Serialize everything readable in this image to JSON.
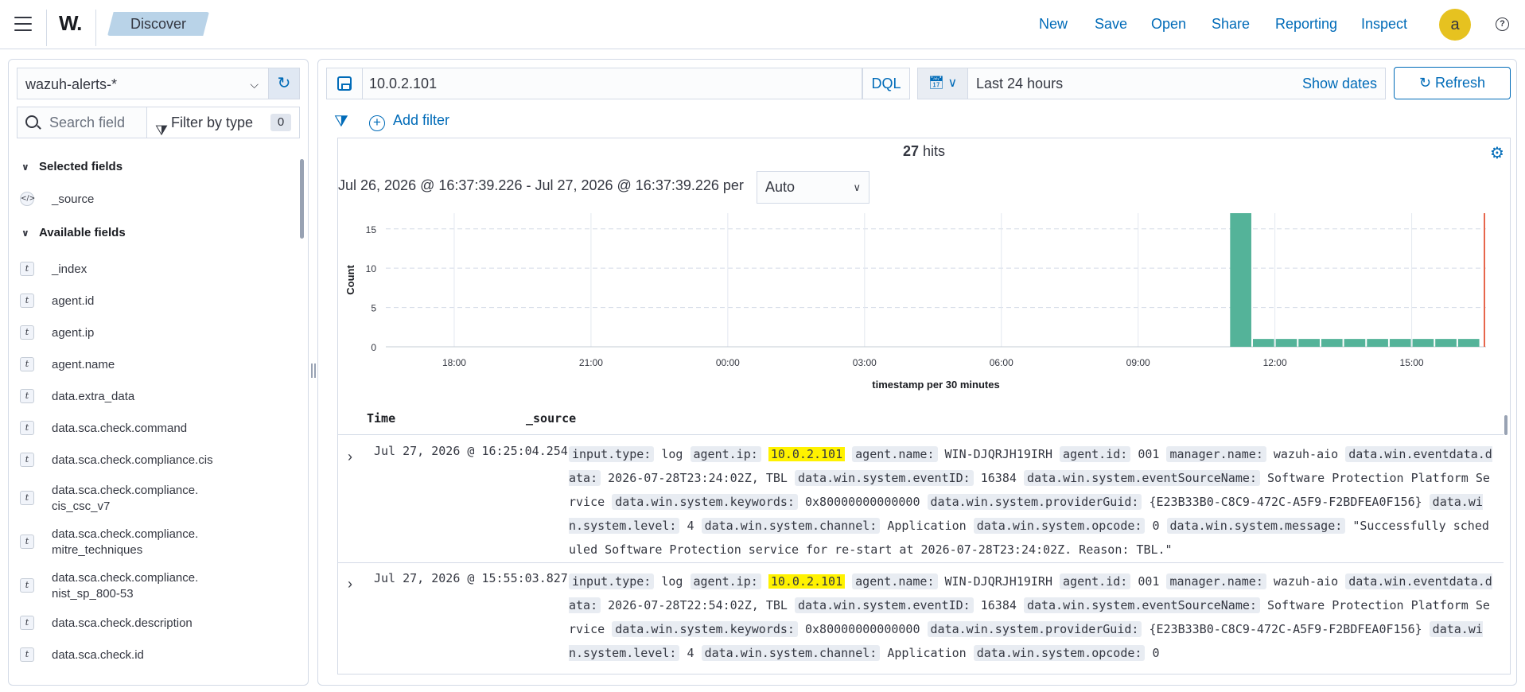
{
  "header": {
    "logo": "W.",
    "breadcrumb": "Discover",
    "nav": [
      "New",
      "Save",
      "Open",
      "Share",
      "Reporting",
      "Inspect"
    ],
    "avatar": "a",
    "help": "?"
  },
  "sidebar": {
    "index_pattern": "wazuh-alerts-*",
    "search_placeholder": "Search field",
    "filter_by_type_label": "Filter by type",
    "filter_count": "0",
    "selected_fields_title": "Selected fields",
    "selected_fields": [
      {
        "name": "_source",
        "type": "source"
      }
    ],
    "available_fields_title": "Available fields",
    "available_fields": [
      {
        "name": "_index",
        "type": "t"
      },
      {
        "name": "agent.id",
        "type": "t"
      },
      {
        "name": "agent.ip",
        "type": "t"
      },
      {
        "name": "agent.name",
        "type": "t"
      },
      {
        "name": "data.extra_data",
        "type": "t"
      },
      {
        "name": "data.sca.check.command",
        "type": "t"
      },
      {
        "name": "data.sca.check.compliance.cis",
        "type": "t"
      },
      {
        "name": "data.sca.check.compliance.\ncis_csc_v7",
        "type": "t"
      },
      {
        "name": "data.sca.check.compliance.\nmitre_techniques",
        "type": "t"
      },
      {
        "name": "data.sca.check.compliance.\nnist_sp_800-53",
        "type": "t"
      },
      {
        "name": "data.sca.check.description",
        "type": "t"
      },
      {
        "name": "data.sca.check.id",
        "type": "t"
      }
    ]
  },
  "query": {
    "value": "10.0.2.101",
    "language": "DQL",
    "time_range": "Last 24 hours",
    "show_dates": "Show dates",
    "refresh": "Refresh",
    "add_filter": "Add filter"
  },
  "results": {
    "hits_count": "27",
    "hits_label": "hits",
    "range_text": "Jul 26, 2026 @ 16:37:39.226 - Jul 27, 2026 @ 16:37:39.226 per",
    "interval": "Auto",
    "col_time": "Time",
    "col_source": "_source",
    "documents": [
      {
        "time": "Jul 27, 2026 @ 16:25:04.254",
        "fields": [
          {
            "k": "input.type:",
            "v": "log"
          },
          {
            "k": "agent.ip:",
            "v": "10.0.2.101",
            "hl": true
          },
          {
            "k": "agent.name:",
            "v": "WIN-DJQRJH19IRH"
          },
          {
            "k": "agent.id:",
            "v": "001"
          },
          {
            "k": "manager.name:",
            "v": "wazuh-aio"
          },
          {
            "k": "data.win.eventdata.data:",
            "v": "2026-07-28T23:24:02Z, TBL"
          },
          {
            "k": "data.win.system.eventID:",
            "v": "16384"
          },
          {
            "k": "data.win.system.eventSourceName:",
            "v": "Software Protection Platform Service"
          },
          {
            "k": "data.win.system.keywords:",
            "v": "0x80000000000000"
          },
          {
            "k": "data.win.system.providerGuid:",
            "v": "{E23B33B0-C8C9-472C-A5F9-F2BDFEA0F156}"
          },
          {
            "k": "data.win.system.level:",
            "v": "4"
          },
          {
            "k": "data.win.system.channel:",
            "v": "Application"
          },
          {
            "k": "data.win.system.opcode:",
            "v": "0"
          },
          {
            "k": "data.win.system.message:",
            "v": "\"Successfully scheduled Software Protection service for re-start at 2026-07-28T23:24:02Z. Reason: TBL.\""
          }
        ]
      },
      {
        "time": "Jul 27, 2026 @ 15:55:03.827",
        "fields": [
          {
            "k": "input.type:",
            "v": "log"
          },
          {
            "k": "agent.ip:",
            "v": "10.0.2.101",
            "hl": true
          },
          {
            "k": "agent.name:",
            "v": "WIN-DJQRJH19IRH"
          },
          {
            "k": "agent.id:",
            "v": "001"
          },
          {
            "k": "manager.name:",
            "v": "wazuh-aio"
          },
          {
            "k": "data.win.eventdata.data:",
            "v": "2026-07-28T22:54:02Z, TBL"
          },
          {
            "k": "data.win.system.eventID:",
            "v": "16384"
          },
          {
            "k": "data.win.system.eventSourceName:",
            "v": "Software Protection Platform Service"
          },
          {
            "k": "data.win.system.keywords:",
            "v": "0x80000000000000"
          },
          {
            "k": "data.win.system.providerGuid:",
            "v": "{E23B33B0-C8C9-472C-A5F9-F2BDFEA0F156}"
          },
          {
            "k": "data.win.system.level:",
            "v": "4"
          },
          {
            "k": "data.win.system.channel:",
            "v": "Application"
          },
          {
            "k": "data.win.system.opcode:",
            "v": "0"
          }
        ]
      }
    ]
  },
  "chart_data": {
    "type": "bar",
    "xlabel": "timestamp per 30 minutes",
    "ylabel": "Count",
    "ylim": [
      0,
      17
    ],
    "yticks": [
      0,
      5,
      10,
      15
    ],
    "x_tick_labels": [
      "18:00",
      "21:00",
      "00:00",
      "03:00",
      "06:00",
      "09:00",
      "12:00",
      "15:00"
    ],
    "x_start_hour": 16.5,
    "x_end_hour": 40.63,
    "bars": [
      {
        "start_hour": 35.0,
        "value": 17
      },
      {
        "start_hour": 35.5,
        "value": 1
      },
      {
        "start_hour": 36.0,
        "value": 1
      },
      {
        "start_hour": 36.5,
        "value": 1
      },
      {
        "start_hour": 37.0,
        "value": 1
      },
      {
        "start_hour": 37.5,
        "value": 1
      },
      {
        "start_hour": 38.0,
        "value": 1
      },
      {
        "start_hour": 38.5,
        "value": 1
      },
      {
        "start_hour": 39.0,
        "value": 1
      },
      {
        "start_hour": 39.5,
        "value": 1
      },
      {
        "start_hour": 40.0,
        "value": 1
      }
    ],
    "bar_color": "#54b399",
    "now_marker_color": "#e7664c",
    "grid": true
  }
}
